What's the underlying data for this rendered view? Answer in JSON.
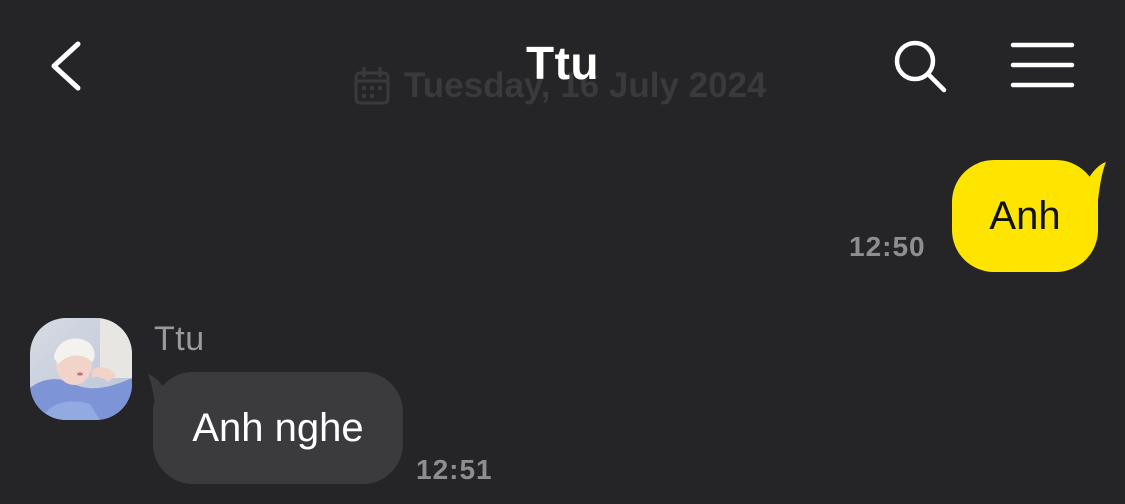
{
  "header": {
    "title": "Ttu",
    "back_icon": "chevron-left-icon",
    "search_icon": "search-icon",
    "menu_icon": "hamburger-menu-icon"
  },
  "date_divider": {
    "icon": "calendar-icon",
    "text": "Tuesday, 16 July 2024"
  },
  "messages": [
    {
      "direction": "outgoing",
      "text": "Anh",
      "time": "12:50"
    },
    {
      "direction": "incoming",
      "sender": "Ttu",
      "text": "Anh nghe",
      "time": "12:51"
    }
  ],
  "colors": {
    "background": "#252527",
    "outgoing_bubble": "#fee500",
    "incoming_bubble": "#3b3b3e",
    "timestamp": "#8e8e92"
  }
}
